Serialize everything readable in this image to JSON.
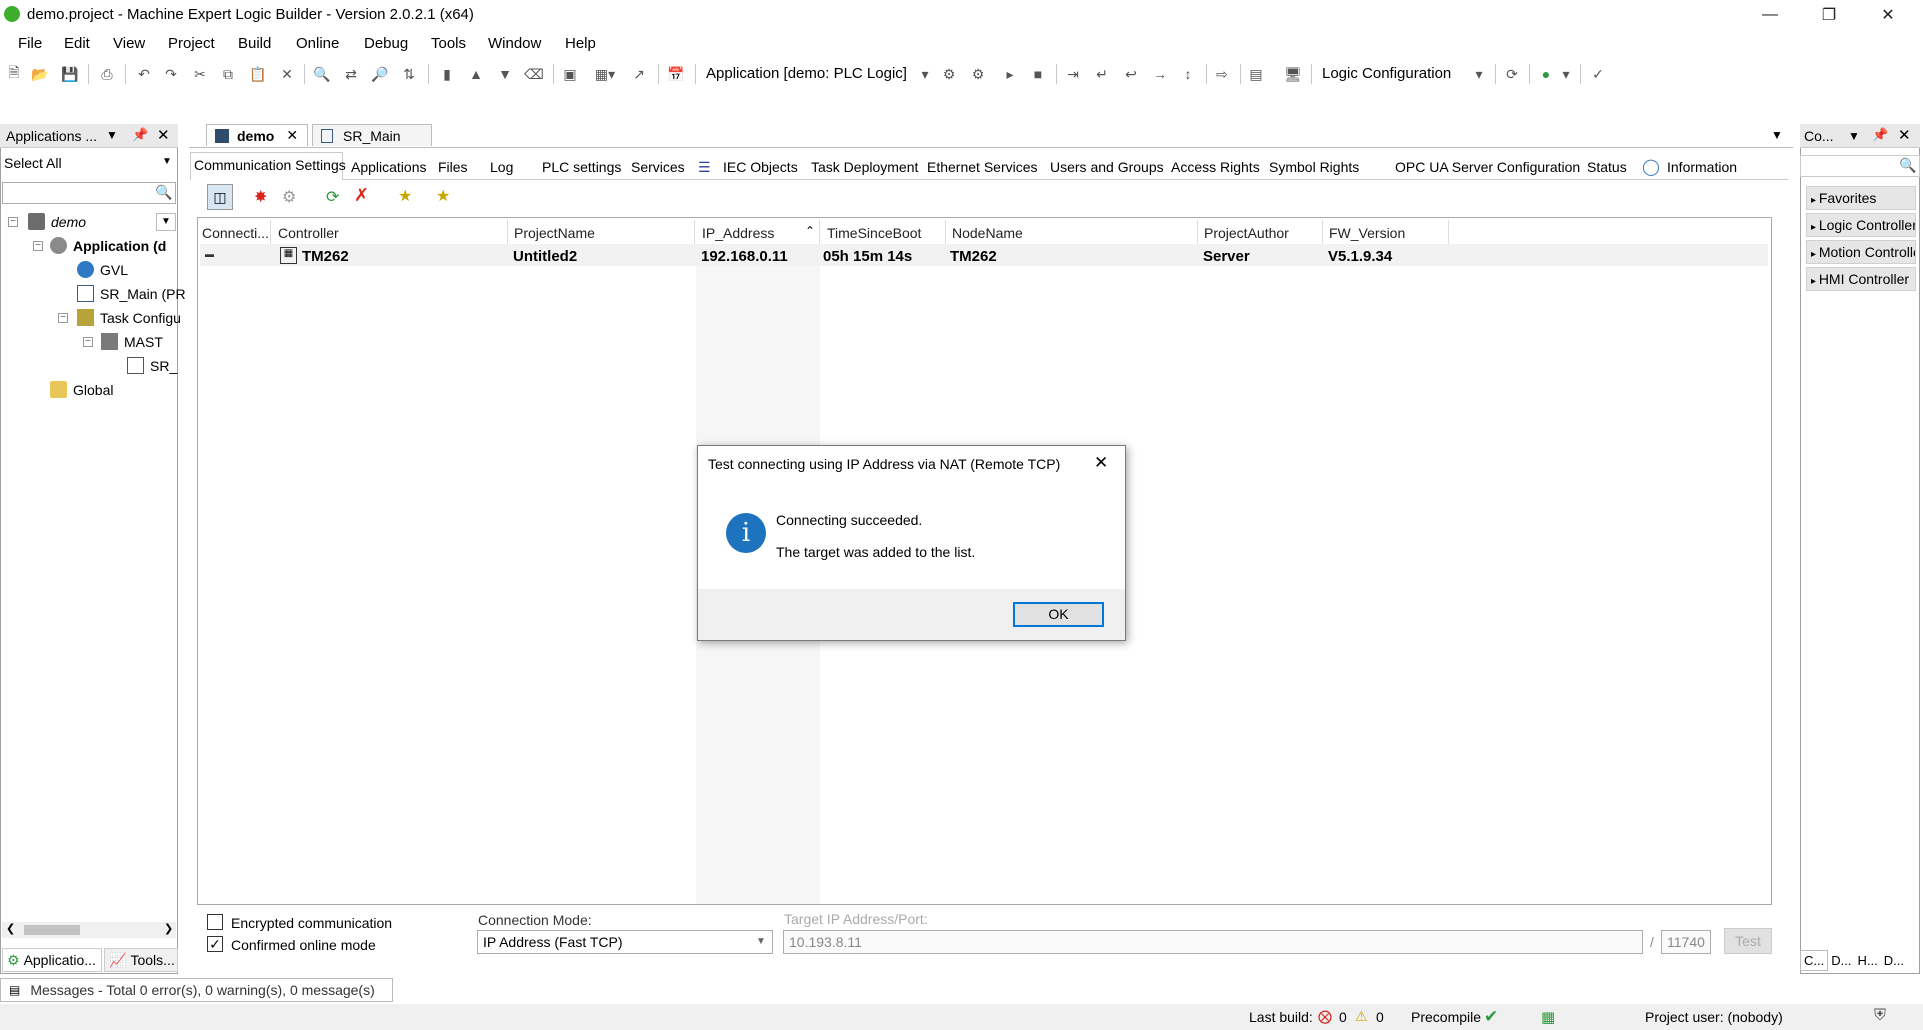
{
  "window": {
    "title": "demo.project - Machine Expert Logic Builder - Version 2.0.2.1 (x64)",
    "minimize_icon": "minimize-icon",
    "maximize_icon": "restore-icon",
    "close_icon": "close-icon"
  },
  "menu": [
    "File",
    "Edit",
    "View",
    "Project",
    "Build",
    "Online",
    "Debug",
    "Tools",
    "Window",
    "Help"
  ],
  "toolbar": {
    "application_combo": "Application [demo: PLC Logic]",
    "configuration_combo": "Logic Configuration"
  },
  "left_panel": {
    "title": "Applications ...",
    "filter": "Select All",
    "tree": {
      "root": "demo",
      "application": "Application (d",
      "gvl": "GVL",
      "sr_main": "SR_Main (PR",
      "task_config": "Task Configu",
      "mast": "MAST",
      "sr_child": "SR_",
      "global": "Global"
    },
    "bottom_tabs": [
      "Applicatio...",
      "Tools..."
    ]
  },
  "editor": {
    "tabs": [
      "demo",
      "SR_Main"
    ],
    "subtabs": [
      "Communication Settings",
      "Applications",
      "Files",
      "Log",
      "PLC settings",
      "Services",
      "IEC Objects",
      "Task Deployment",
      "Ethernet Services",
      "Users and Groups",
      "Access Rights",
      "Symbol Rights",
      "OPC UA Server Configuration",
      "Status",
      "Information"
    ],
    "columns": [
      "Connecti...",
      "Controller",
      "ProjectName",
      "IP_Address",
      "TimeSinceBoot",
      "NodeName",
      "ProjectAuthor",
      "FW_Version"
    ],
    "rows": [
      {
        "controller": "TM262",
        "project": "Untitled2",
        "ip": "192.168.0.11",
        "boot": "05h 15m 14s",
        "node": "TM262",
        "author": "Server",
        "fw": "V5.1.9.34"
      }
    ],
    "encrypted_label": "Encrypted communication",
    "confirmed_label": "Confirmed online mode",
    "confirmed_checked": "✓",
    "connection_mode_label": "Connection Mode:",
    "connection_mode_value": "IP Address (Fast TCP)",
    "target_label": "Target IP Address/Port:",
    "target_value": "10.193.8.11",
    "port_sep": "/",
    "port_value": "11740",
    "test_button": "Test"
  },
  "right_panel": {
    "title": "Co...",
    "items": [
      "Favorites",
      "Logic Controller",
      "Motion Controlle",
      "HMI Controller"
    ],
    "bottom_tabs": [
      "C...",
      "D...",
      "H...",
      "D..."
    ]
  },
  "messages": "Messages - Total 0 error(s), 0 warning(s), 0 message(s)",
  "status": {
    "last_build": "Last build:",
    "errors": "0",
    "warnings": "0",
    "precompile": "Precompile",
    "project_user": "Project user: (nobody)"
  },
  "dialog": {
    "title": "Test connecting using IP Address via NAT (Remote TCP)",
    "line1": "Connecting succeeded.",
    "line2": "The target was added to the list.",
    "ok": "OK",
    "info_glyph": "i"
  },
  "colors": {
    "accent": "#0078d7",
    "info_icon": "#1e73be",
    "error_icon": "#d9261c",
    "warning_icon": "#f0c419",
    "ok_check": "#2c9a3a"
  }
}
